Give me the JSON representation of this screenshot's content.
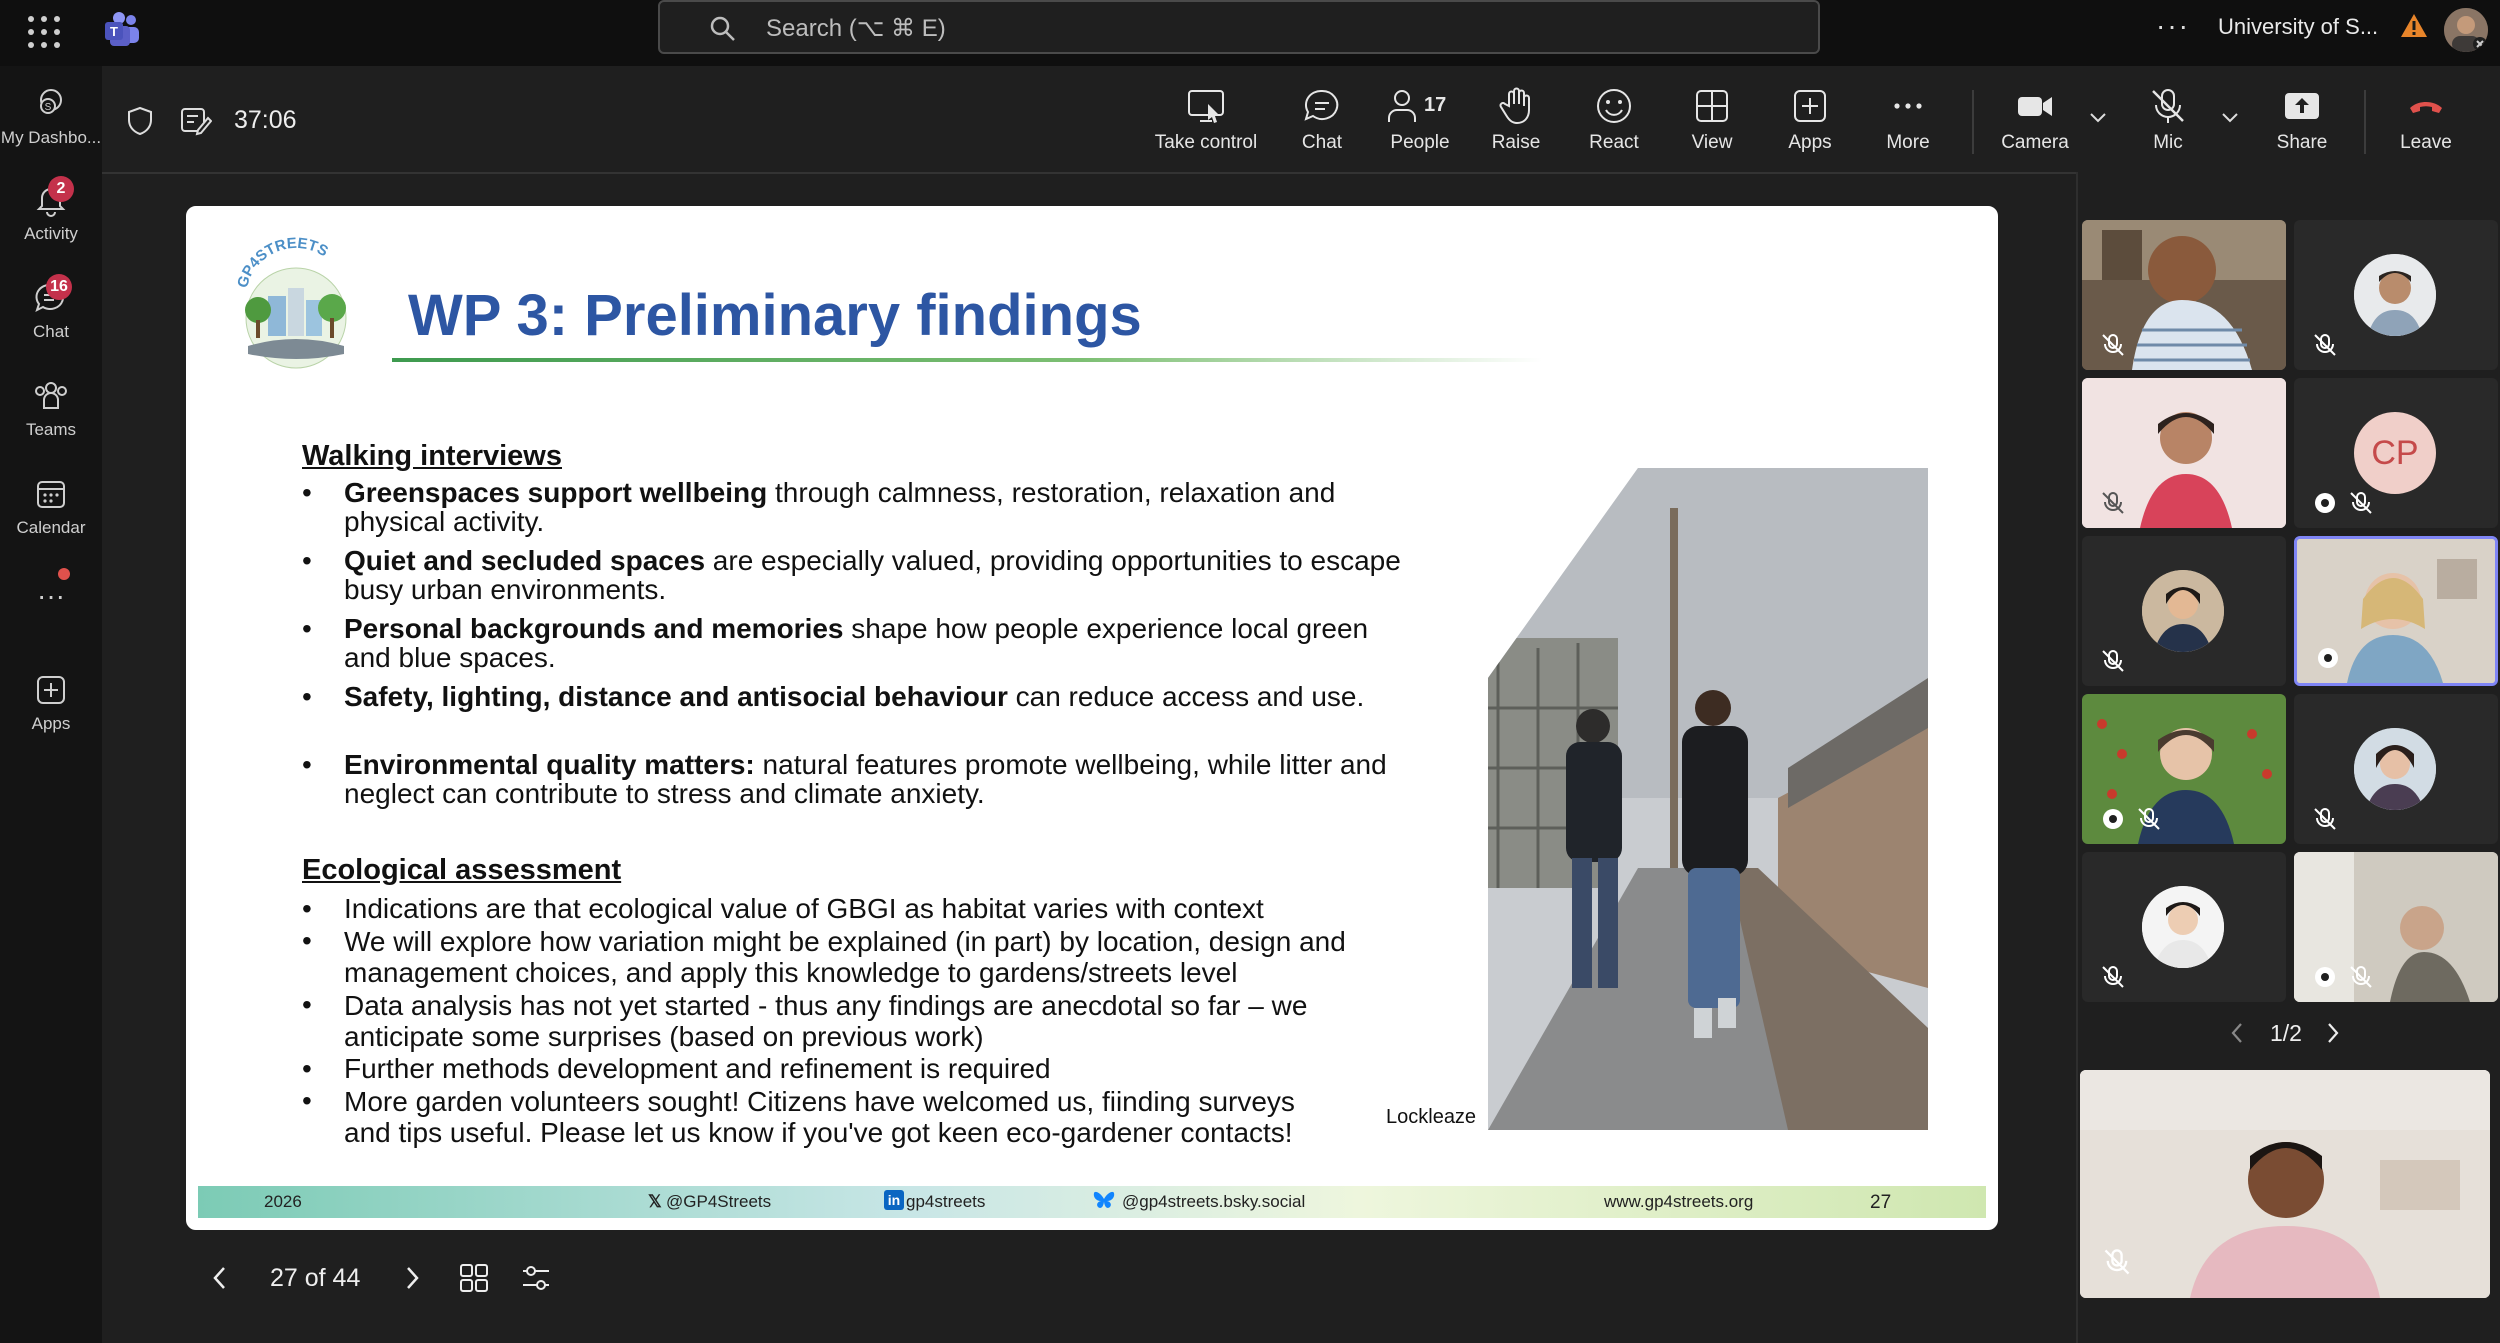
{
  "topbar": {
    "search_placeholder": "Search (⌥ ⌘ E)",
    "more_label": "···",
    "org_name": "University of S..."
  },
  "rail": {
    "items": [
      {
        "label": "My Dashbo...",
        "icon": "dashboard-icon"
      },
      {
        "label": "Activity",
        "icon": "bell-icon",
        "badge": "2"
      },
      {
        "label": "Chat",
        "icon": "chat-icon",
        "badge": "16"
      },
      {
        "label": "Teams",
        "icon": "teams-icon"
      },
      {
        "label": "Calendar",
        "icon": "calendar-icon"
      },
      {
        "label": "···",
        "icon": "more-icon"
      },
      {
        "label": "Apps",
        "icon": "apps-icon"
      }
    ]
  },
  "meeting": {
    "timer": "37:06",
    "toolbar": {
      "take_control": "Take control",
      "chat": "Chat",
      "people": "People",
      "people_count": "17",
      "raise": "Raise",
      "react": "React",
      "view": "View",
      "apps": "Apps",
      "more": "More",
      "camera": "Camera",
      "mic": "Mic",
      "share": "Share",
      "leave": "Leave"
    }
  },
  "slide": {
    "logo_text": "GP4STREETS",
    "title": "WP 3: Preliminary findings",
    "section1": "Walking interviews",
    "bullets1": [
      {
        "bold": "Greenspaces support wellbeing",
        "rest": " through calmness, restoration, relaxation and physical activity."
      },
      {
        "bold": "Quiet and secluded spaces",
        "rest": " are especially valued, providing opportunities to escape busy urban environments."
      },
      {
        "bold": "Personal backgrounds and memories",
        "rest": " shape how people experience local green and blue spaces."
      },
      {
        "bold": "Safety, lighting, distance and antisocial behaviour",
        "rest": " can reduce access and use."
      },
      {
        "bold": "Environmental quality matters:",
        "rest": " natural features promote wellbeing, while litter and neglect can contribute to stress and climate anxiety."
      }
    ],
    "section2": "Ecological assessment",
    "bullets2": [
      "Indications are that ecological value of GBGI as habitat varies with context",
      "We will explore how variation might be explained (in part) by location, design and management choices, and apply this knowledge to gardens/streets level",
      "Data analysis has not yet started - thus any findings are anecdotal so far – we anticipate some surprises (based on previous work)",
      "Further methods development and refinement is required",
      "More garden volunteers sought! Citizens have welcomed us, fiinding surveys and tips useful. Please let us know if you've got keen eco-gardener contacts!"
    ],
    "bullet_char": "•",
    "photo_caption": "Lockleaze",
    "footer": {
      "year": "2026",
      "x_handle": "@GP4Streets",
      "linkedin": "gp4streets",
      "bsky": "@gp4streets.bsky.social",
      "website": "www.gp4streets.org",
      "page": "27"
    }
  },
  "slide_nav": {
    "position": "27 of 44"
  },
  "participants": {
    "cp_initials": "CP",
    "pager": "1/2"
  },
  "colors": {
    "title_blue": "#2d56a3",
    "badge_red": "#c4314b",
    "leave_red": "#e0514c",
    "accent_purple": "#7f85f5"
  }
}
